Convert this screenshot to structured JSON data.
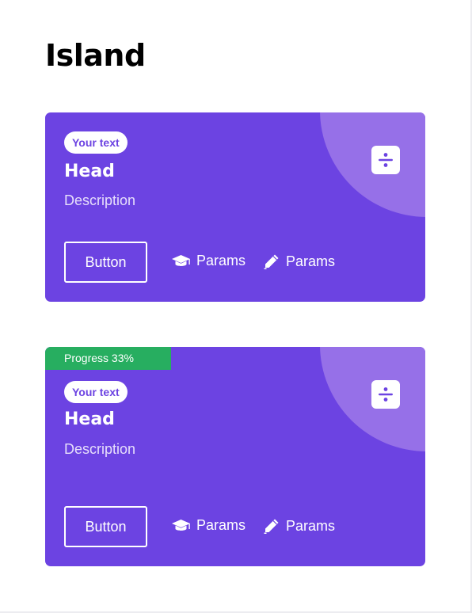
{
  "page": {
    "title": "Island"
  },
  "cards": [
    {
      "badge": "Your text",
      "head": "Head",
      "description": "Description",
      "button_label": "Button",
      "params": [
        {
          "icon": "graduation-cap-icon",
          "label": "Params"
        },
        {
          "icon": "pencil-icon",
          "label": "Params"
        }
      ],
      "action_icon": "divide-icon"
    },
    {
      "progress_label": "Progress 33%",
      "progress": 0.33,
      "badge": "Your text",
      "head": "Head",
      "description": "Description",
      "button_label": "Button",
      "params": [
        {
          "icon": "graduation-cap-icon",
          "label": "Params"
        },
        {
          "icon": "pencil-icon",
          "label": "Params"
        }
      ],
      "action_icon": "divide-icon"
    }
  ],
  "colors": {
    "card_background": "#6c43e2",
    "decor_circle": "#9670e8",
    "progress": "#27ae60",
    "text_on_card": "#ffffff"
  }
}
